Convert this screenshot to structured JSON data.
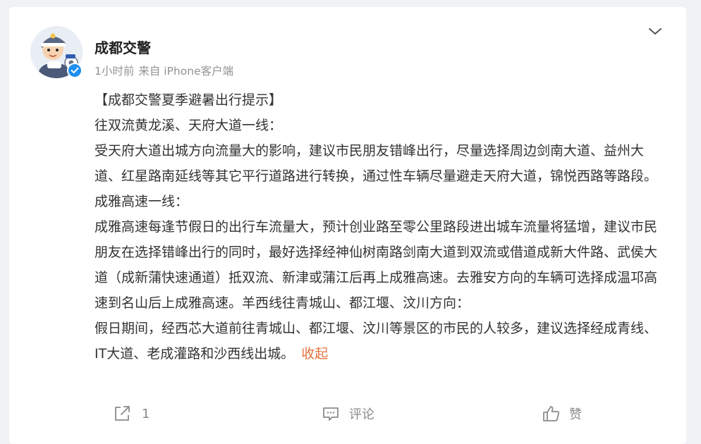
{
  "post": {
    "author": "成都交警",
    "time": "1小时前",
    "source": "来自 iPhone客户端",
    "content": [
      "【成都交警夏季避暑出行提示】",
      "往双流黄龙溪、天府大道一线：",
      "受天府大道出城方向流量大的影响，建议市民朋友错峰出行，尽量选择周边剑南大道、益州大道、红星路南延线等其它平行道路进行转换，通过性车辆尽量避走天府大道，锦悦西路等路段。成雅高速一线：",
      "成雅高速每逢节假日的出行车流量大，预计创业路至零公里路段进出城车流量将猛增，建议市民朋友在选择错峰出行的同时，最好选择经神仙树南路剑南大道到双流或借道成新大件路、武侯大道（成新蒲快速通道）抵双流、新津或蒲江后再上成雅高速。去雅安方向的车辆可选择成温邛高速到名山后上成雅高速。羊西线往青城山、都江堰、汶川方向：",
      "假日期间，经西芯大道前往青城山、都江堰、汶川等景区的市民的人较多，建议选择经成青线、IT大道、老成灌路和沙西线出城。"
    ],
    "collapse_label": "收起"
  },
  "actions": {
    "share_count": "1",
    "comment_label": "评论",
    "like_label": "赞"
  },
  "icons": {
    "more": "chevron-down-icon",
    "verified": "verified-badge-icon",
    "share": "share-icon",
    "comment": "comment-icon",
    "like": "thumbs-up-icon"
  },
  "colors": {
    "accent": "#e5733d",
    "verified": "#1f8ff0",
    "meta_text": "#939393",
    "body_text": "#333333",
    "background": "#f1f2f5"
  }
}
